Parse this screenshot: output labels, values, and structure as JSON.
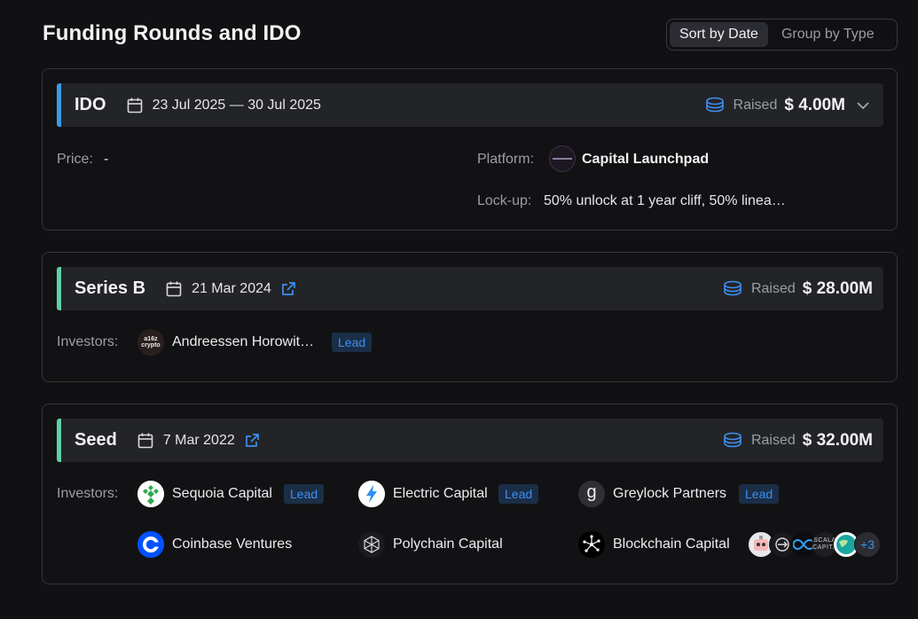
{
  "page": {
    "title": "Funding Rounds and IDO"
  },
  "view_toggle": {
    "sort_by_date": "Sort by Date",
    "group_by_type": "Group by Type"
  },
  "colors": {
    "accent_blue": "#3d8ff0",
    "ido_bar": "#3b9be6",
    "series_bar": "#5fd0a7",
    "seed_bar": "#5fd0a7"
  },
  "rounds": {
    "ido": {
      "name": "IDO",
      "date": "23 Jul 2025 — 30 Jul 2025",
      "raised_label": "Raised",
      "raised_value": "$ 4.00M",
      "price_label": "Price:",
      "price_value": "-",
      "platform_label": "Platform:",
      "platform_value": "Capital Launchpad",
      "lockup_label": "Lock-up:",
      "lockup_value": "50% unlock at 1 year cliff, 50% linea…"
    },
    "series_b": {
      "name": "Series B",
      "date": "21 Mar 2024",
      "raised_label": "Raised",
      "raised_value": "$ 28.00M",
      "investors_label": "Investors:",
      "investors": [
        {
          "name": "Andreessen Horowit…",
          "lead": "Lead",
          "logo_text": "a16z crypto"
        }
      ]
    },
    "seed": {
      "name": "Seed",
      "date": "7 Mar 2022",
      "raised_label": "Raised",
      "raised_value": "$ 32.00M",
      "investors_label": "Investors:",
      "investors": [
        {
          "name": "Sequoia Capital",
          "lead": "Lead",
          "icon": "sequoia-icon"
        },
        {
          "name": "Electric Capital",
          "lead": "Lead",
          "icon": "bolt-icon"
        },
        {
          "name": "Greylock Partners",
          "lead": "Lead",
          "icon": "greylock-icon",
          "logo_text": "g"
        },
        {
          "name": "Coinbase Ventures",
          "icon": "coinbase-icon"
        },
        {
          "name": "Polychain Capital",
          "icon": "polychain-icon"
        },
        {
          "name": "Blockchain Capital",
          "icon": "blockchain-capital-icon"
        }
      ],
      "more_count": "+3",
      "more_logo_text": "SCALA CAPITA"
    }
  }
}
